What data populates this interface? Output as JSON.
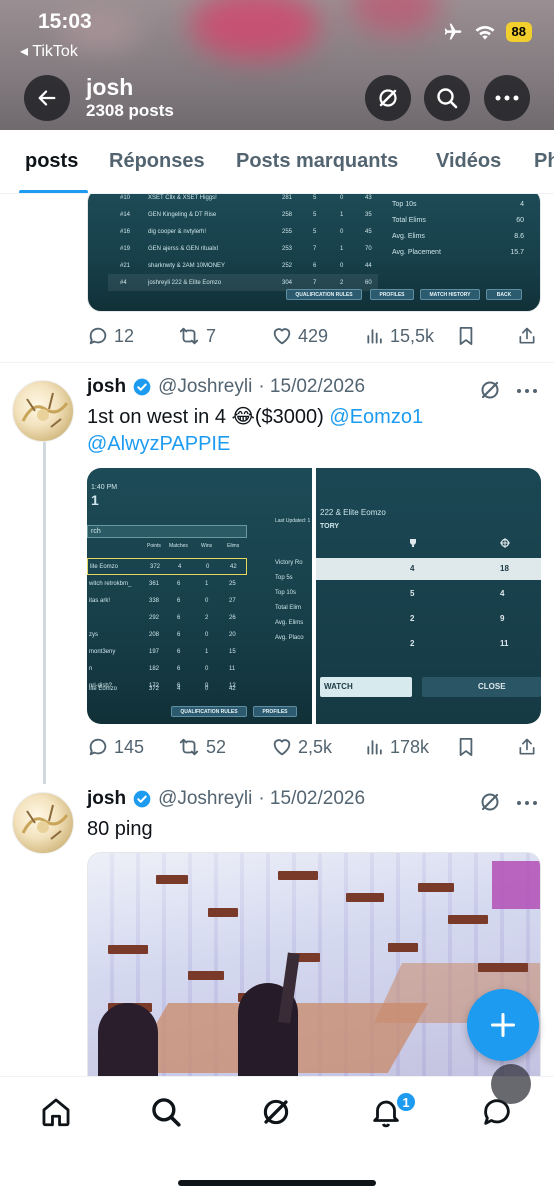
{
  "status_bar": {
    "time": "15:03",
    "back_app": "◂ TikTok",
    "battery": "88"
  },
  "profile": {
    "name": "josh",
    "post_count": "2308 posts"
  },
  "tabs": [
    {
      "label": "posts",
      "active": true
    },
    {
      "label": "Réponses",
      "active": false
    },
    {
      "label": "Posts marquants",
      "active": false
    },
    {
      "label": "Vidéos",
      "active": false
    },
    {
      "label": "Ph",
      "active": false
    }
  ],
  "post0": {
    "image": {
      "rows": [
        {
          "rank": "#10",
          "team": "XSET Cllx & XSET Higgs!",
          "pts": "281",
          "m": "5",
          "w": "0",
          "e": "43"
        },
        {
          "rank": "#14",
          "team": "GEN Kingeling & DT Rise",
          "pts": "258",
          "m": "5",
          "w": "1",
          "e": "35"
        },
        {
          "rank": "#16",
          "team": "dig cooper & nvtylerh!",
          "pts": "255",
          "m": "5",
          "w": "0",
          "e": "45"
        },
        {
          "rank": "#19",
          "team": "GEN ajerss & GEN ritualxl",
          "pts": "253",
          "m": "7",
          "w": "1",
          "e": "70"
        },
        {
          "rank": "#21",
          "team": "sharknwty & 2AM 10MONEY",
          "pts": "252",
          "m": "6",
          "w": "0",
          "e": "44"
        },
        {
          "rank": "#4",
          "team": "joshreyli 222 & Elite Eomzo",
          "pts": "304",
          "m": "7",
          "w": "2",
          "e": "60"
        }
      ],
      "stats": [
        {
          "label": "Top 10s",
          "value": "4"
        },
        {
          "label": "Total Elims",
          "value": "60"
        },
        {
          "label": "Avg. Elims",
          "value": "8.6"
        },
        {
          "label": "Avg. Placement",
          "value": "15.7"
        }
      ],
      "buttons": [
        "QUALIFICATION RULES",
        "PROFILES",
        "MATCH HISTORY",
        "BACK"
      ]
    },
    "replies": "12",
    "reposts": "7",
    "likes": "429",
    "views": "15,5k"
  },
  "post1": {
    "name": "josh",
    "handle": "@Joshreyli",
    "date": "· 15/02/2026",
    "text": "1st on west in 4 😂($3000) ",
    "mention1": "@Eomzo1",
    "mention2": "@AlwyzPAPPIE",
    "image_left": {
      "time": "1:40 PM",
      "title": "1",
      "search": "rch",
      "headers": [
        "Points",
        "Matches",
        "Wins",
        "Elims"
      ],
      "last_updated": "Last Updated: 1",
      "rows": [
        {
          "team": "lite Eomzo",
          "pts": "372",
          "m": "4",
          "w": "0",
          "e": "42"
        },
        {
          "team": "witch retrokbm_",
          "pts": "361",
          "m": "6",
          "w": "1",
          "e": "25"
        },
        {
          "team": "itas ark!",
          "pts": "338",
          "m": "6",
          "w": "0",
          "e": "27"
        },
        {
          "team": "",
          "pts": "292",
          "m": "6",
          "w": "2",
          "e": "26"
        },
        {
          "team": "zys",
          "pts": "208",
          "m": "6",
          "w": "0",
          "e": "20"
        },
        {
          "team": "mont3eny",
          "pts": "197",
          "m": "6",
          "w": "1",
          "e": "15"
        },
        {
          "team": "n",
          "pts": "182",
          "m": "6",
          "w": "0",
          "e": "11"
        },
        {
          "team": "nri-dish?",
          "pts": "172",
          "m": "6",
          "w": "0",
          "e": "12"
        },
        {
          "team": "lite Eomzo",
          "pts": "372",
          "m": "4",
          "w": "0",
          "e": "42"
        }
      ],
      "side": [
        "Victory Ro",
        "Top 5s",
        "Top 10s",
        "Total Elim",
        "Avg. Elims",
        "Avg. Placo"
      ],
      "buttons": [
        "QUALIFICATION RULES",
        "PROFILES"
      ]
    },
    "image_right": {
      "team": "222 & Elite Eomzo",
      "history": "TORY",
      "rows": [
        [
          "4",
          "18"
        ],
        [
          "5",
          "4"
        ],
        [
          "2",
          "9"
        ],
        [
          "2",
          "11"
        ]
      ],
      "watch": "WATCH",
      "close": "CLOSE"
    },
    "replies": "145",
    "reposts": "52",
    "likes": "2,5k",
    "views": "178k"
  },
  "post2": {
    "name": "josh",
    "handle": "@Joshreyli",
    "date": "· 15/02/2026",
    "text": "80 ping"
  },
  "colors": {
    "accent": "#1d9bf0",
    "text": "#0f1419",
    "muted": "#536471"
  },
  "icons": [
    "back-arrow-icon",
    "grok-icon",
    "search-icon",
    "more-icon",
    "reply-icon",
    "repost-icon",
    "like-icon",
    "views-icon",
    "bookmark-icon",
    "share-icon",
    "home-icon",
    "notifications-icon",
    "messages-icon",
    "compose-icon"
  ],
  "nav": {
    "notif_badge": "1"
  }
}
